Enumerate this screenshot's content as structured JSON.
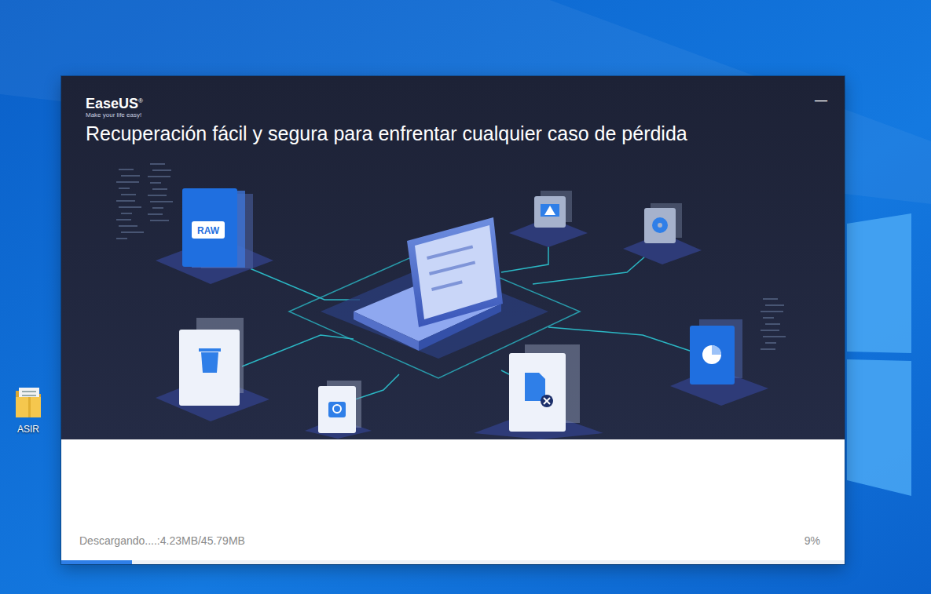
{
  "desktop": {
    "icons": [
      {
        "label": "ASIR"
      }
    ]
  },
  "installer": {
    "brand": "EaseUS",
    "brand_mark": "®",
    "tagline": "Make your life easy!",
    "headline": "Recuperación fácil y segura para enfrentar cualquier caso de pérdida",
    "minimize": "—",
    "illustration": {
      "raw_label": "RAW"
    },
    "status": "Descargando....:4.23MB/45.79MB",
    "percent": "9%",
    "level": 0.09
  }
}
